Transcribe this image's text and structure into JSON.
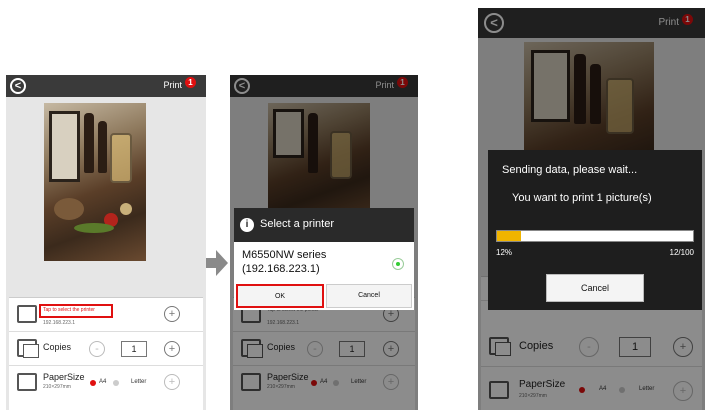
{
  "topbar": {
    "back_symbol": "<",
    "print_label": "Print",
    "badge_count": "1"
  },
  "settings": {
    "tap_text": "Tap to select the printer",
    "ip_small": "192.168.223.1",
    "copies_label": "Copies",
    "copies_value": "1",
    "minus": "-",
    "plus": "+",
    "paper_label": "PaperSize",
    "paper_dims": "210×297mm",
    "paper_opt_a4": "A4",
    "paper_opt_letter": "Letter"
  },
  "select_dialog": {
    "title": "Select a printer",
    "info_symbol": "i",
    "printer_line1": "M6550NW series",
    "printer_line2": "(192.168.223.1)",
    "ok_label": "OK",
    "cancel_label": "Cancel"
  },
  "send_dialog": {
    "title": "Sending data, please wait...",
    "message": "You want to print 1 picture(s)",
    "progress_percent": "12%",
    "progress_count": "12/100",
    "progress_fraction": 0.12,
    "cancel_label": "Cancel"
  },
  "colors": {
    "topbar": "#3a3a3a",
    "badge": "#e01010",
    "highlight": "#e01010",
    "progress": "#f0b400",
    "dialog_dark": "#1e1e1e"
  },
  "icons": [
    "back-icon",
    "printer-icon",
    "copies-icon",
    "paper-size-icon",
    "info-icon",
    "radio-selected-icon",
    "arrow-right-icon"
  ]
}
